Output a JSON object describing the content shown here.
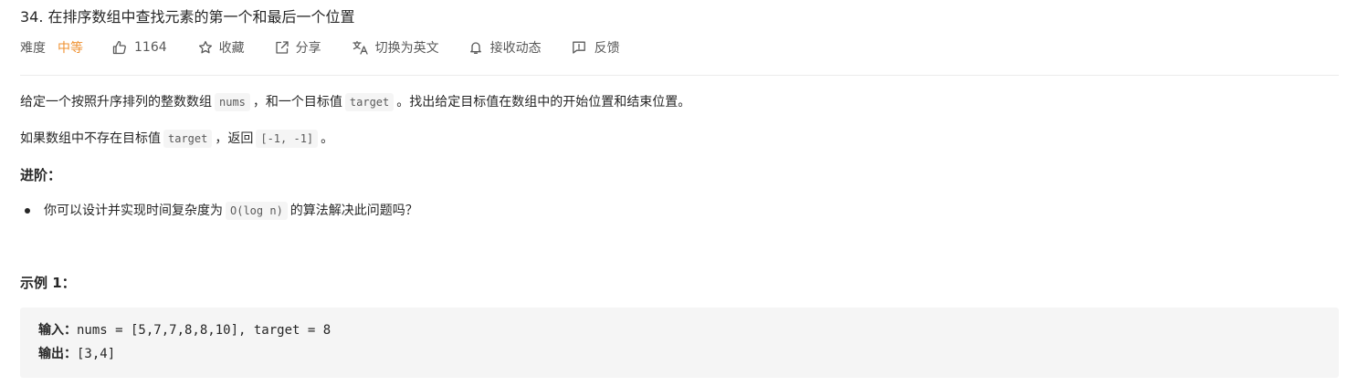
{
  "problem": {
    "title": "34. 在排序数组中查找元素的第一个和最后一个位置"
  },
  "meta": {
    "difficulty_label": "难度",
    "difficulty_value": "中等",
    "difficulty_color": "#ef9131",
    "likes_icon": "thumbs-up-icon",
    "likes_count": "1164",
    "favorite_icon": "star-icon",
    "favorite_label": "收藏",
    "share_icon": "share-icon",
    "share_label": "分享",
    "translate_icon": "translate-icon",
    "translate_label": "切换为英文",
    "subscribe_icon": "bell-icon",
    "subscribe_label": "接收动态",
    "feedback_icon": "feedback-icon",
    "feedback_label": "反馈"
  },
  "description": {
    "p1_a": "给定一个按照升序排列的整数数组",
    "p1_code1": "nums",
    "p1_b": "，和一个目标值",
    "p1_code2": "target",
    "p1_c": "。找出给定目标值在数组中的开始位置和结束位置。",
    "p2_a": "如果数组中不存在目标值",
    "p2_code1": "target",
    "p2_b": "，返回",
    "p2_code2": "[-1, -1]",
    "p2_c": "。"
  },
  "advanced": {
    "heading": "进阶：",
    "item_a": "你可以设计并实现时间复杂度为",
    "item_code": "O(log n)",
    "item_b": "的算法解决此问题吗？"
  },
  "example1": {
    "heading": "示例 1：",
    "input_label": "输入：",
    "input_value": "nums = [5,7,7,8,8,10], target = 8",
    "output_label": "输出：",
    "output_value": "[3,4]"
  }
}
